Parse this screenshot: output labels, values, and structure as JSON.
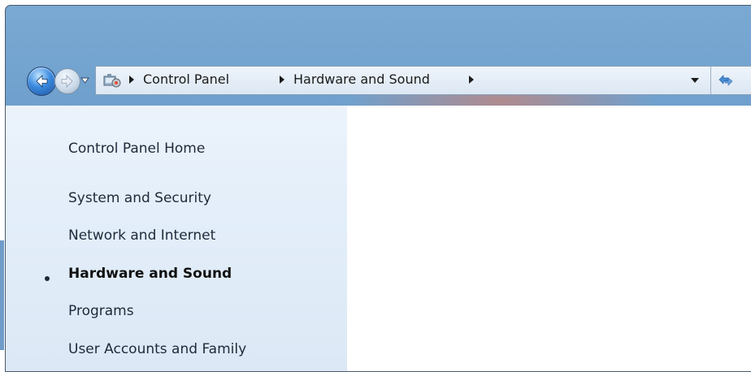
{
  "breadcrumb": {
    "items": [
      "Control Panel",
      "Hardware and Sound"
    ]
  },
  "sidebar": {
    "home": "Control Panel Home",
    "items": [
      {
        "label": "System and Security",
        "current": false
      },
      {
        "label": "Network and Internet",
        "current": false
      },
      {
        "label": "Hardware and Sound",
        "current": true
      },
      {
        "label": "Programs",
        "current": false
      },
      {
        "label": "User Accounts and Family",
        "current": false
      }
    ]
  },
  "icons": {
    "back": "back-arrow-icon",
    "forward": "forward-arrow-icon",
    "recent": "chevron-down-icon",
    "location": "control-panel-icon",
    "address_dropdown": "chevron-down-icon",
    "refresh": "refresh-icon"
  },
  "colors": {
    "titlebar": "#6e9fcc",
    "sidebar": "#e3eefa",
    "address_bar": "#e6eef8"
  }
}
